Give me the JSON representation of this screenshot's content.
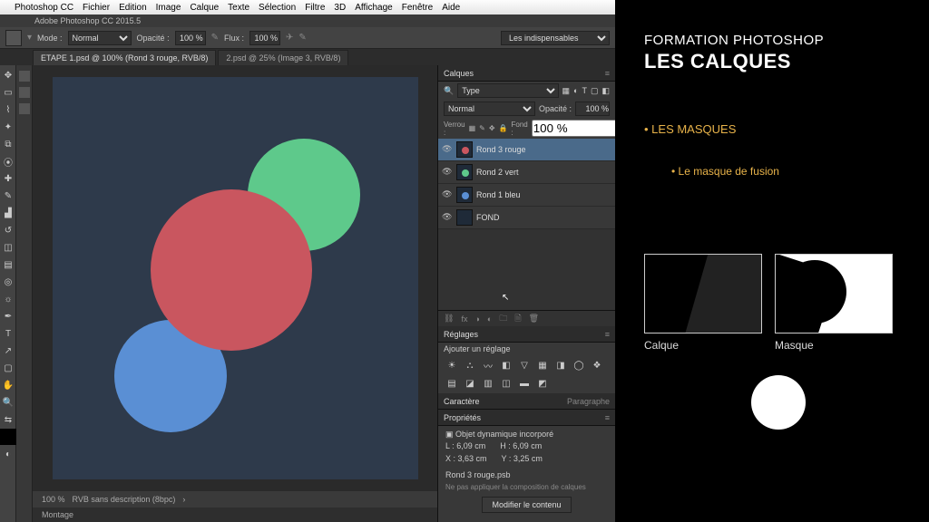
{
  "mac_menu": [
    "Photoshop CC",
    "Fichier",
    "Edition",
    "Image",
    "Calque",
    "Texte",
    "Sélection",
    "Filtre",
    "3D",
    "Affichage",
    "Fenêtre",
    "Aide"
  ],
  "window_title": "Adobe Photoshop CC 2015.5",
  "option_bar": {
    "mode_label": "Mode :",
    "mode_value": "Normal",
    "opacity_label": "Opacité :",
    "opacity_value": "100 %",
    "flux_label": "Flux :",
    "flux_value": "100 %",
    "preset_value": "Les indispensables"
  },
  "tabs": {
    "active": "ETAPE 1.psd @ 100% (Rond 3 rouge, RVB/8)",
    "inactive": "2.psd @ 25% (Image 3, RVB/8)"
  },
  "status": {
    "zoom": "100 %",
    "info": "RVB sans description (8bpc)",
    "montage": "Montage"
  },
  "layers_panel": {
    "title": "Calques",
    "type_label": "Type",
    "blend_value": "Normal",
    "opacity_label": "Opacité :",
    "opacity_value": "100 %",
    "lock_label": "Verrou :",
    "fill_label": "Fond :",
    "fill_value": "100 %",
    "layers": [
      {
        "name": "Rond 3 rouge",
        "color": "#c9565f",
        "selected": true
      },
      {
        "name": "Rond 2 vert",
        "color": "#5ec98b",
        "selected": false
      },
      {
        "name": "Rond 1 bleu",
        "color": "#5a8fd4",
        "selected": false
      },
      {
        "name": "FOND",
        "color": "",
        "selected": false
      }
    ]
  },
  "adjustments": {
    "title": "Réglages",
    "hint": "Ajouter un réglage"
  },
  "char_para": {
    "char": "Caractère",
    "para": "Paragraphe"
  },
  "properties": {
    "title": "Propriétés",
    "kind": "Objet dynamique incorporé",
    "L_lbl": "L :",
    "L_val": "6,09 cm",
    "H_lbl": "H :",
    "H_val": "6,09 cm",
    "X_lbl": "X :",
    "X_val": "3,63 cm",
    "Y_lbl": "Y :",
    "Y_val": "3,25 cm",
    "file": "Rond 3 rouge.psb",
    "note": "Ne pas appliquer la composition de calques",
    "button": "Modifier le contenu"
  },
  "slide": {
    "sup": "FORMATION PHOTOSHOP",
    "title": "LES CALQUES",
    "bullet1": "LES MASQUES",
    "bullet2": "Le masque de fusion",
    "cap_left": "Calque",
    "cap_right": "Masque"
  }
}
